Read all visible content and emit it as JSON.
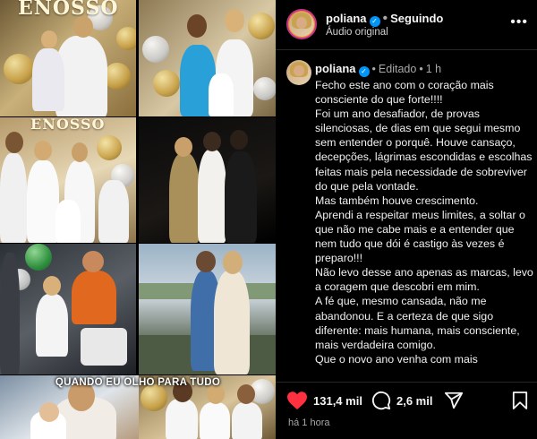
{
  "media": {
    "banner_text_1": "ENOSSO",
    "banner_text_2": "ENOSSO",
    "overlay_caption": "QUANDO EU OLHO PARA TUDO"
  },
  "post": {
    "username": "poliana",
    "following_label": "Seguindo",
    "audio_label": "Áudio original",
    "edited_label": "Editado",
    "time_ago": "1 h",
    "caption": "Fecho este ano com o coração mais consciente do que forte!!!!\nFoi um ano desafiador, de provas silenciosas, de dias em que segui mesmo sem entender o porquê. Houve cansaço, decepções, lágrimas escondidas e escolhas feitas mais pela necessidade de sobreviver do que pela vontade.\nMas também houve crescimento.\nAprendi a respeitar meus limites, a soltar o que não me cabe mais e a entender que nem tudo que dói é castigo às vezes é preparo!!!\nNão levo desse ano apenas as marcas, levo a coragem que descobri em mim.\nA fé que, mesmo cansada, não me abandonou. E a certeza de que sigo diferente: mais humana, mais consciente, mais verdadeira comigo.\nQue o novo ano venha com mais",
    "likes": "131,4 mil",
    "comments": "2,6 mil",
    "posted_ago": "há 1 hora"
  },
  "colors": {
    "background": "#000000",
    "text_primary": "#f5f5f5",
    "text_secondary": "#a8a8a8",
    "verified_badge": "#0095f6",
    "like_heart": "#ff3040",
    "story_ring": "#c13584"
  },
  "icons": [
    "verified-badge-icon",
    "more-options-icon",
    "heart-icon",
    "comment-icon",
    "share-icon",
    "bookmark-icon"
  ]
}
